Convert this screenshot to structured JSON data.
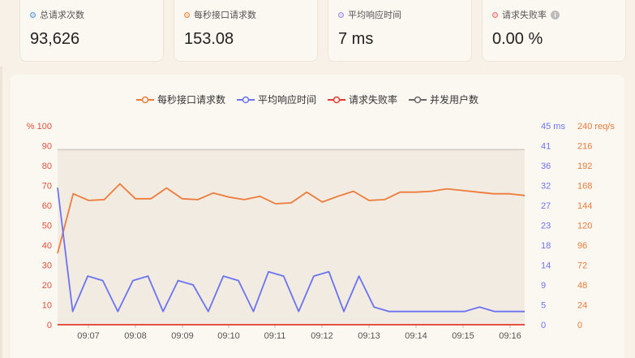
{
  "stats": [
    {
      "label": "总请求次数",
      "value": "93,626",
      "dot_color": "#5b9bd5",
      "dot_fill": "#cfe1f3"
    },
    {
      "label": "每秒接口请求数",
      "value": "153.08",
      "dot_color": "#ee8a46",
      "dot_fill": "#fbdcc6"
    },
    {
      "label": "平均响应时间",
      "value": "7 ms",
      "dot_color": "#9b8fe0",
      "dot_fill": "#e4dff8"
    },
    {
      "label": "请求失败率",
      "value": "0.00 %",
      "dot_color": "#e57070",
      "dot_fill": "#f8d3d3",
      "info": "i"
    }
  ],
  "legend": [
    {
      "label": "每秒接口请求数",
      "color": "#ed7b3a"
    },
    {
      "label": "平均响应时间",
      "color": "#6b73f0"
    },
    {
      "label": "请求失败率",
      "color": "#e23a2e"
    },
    {
      "label": "并发用户数",
      "color": "#666666"
    }
  ],
  "chart_data": {
    "type": "line",
    "x": [
      "09:06:40",
      "09:06:50",
      "09:07:00",
      "09:07:10",
      "09:07:20",
      "09:07:30",
      "09:07:40",
      "09:07:50",
      "09:08:00",
      "09:08:10",
      "09:08:20",
      "09:08:30",
      "09:08:40",
      "09:08:50",
      "09:09:00",
      "09:09:10",
      "09:09:20",
      "09:09:30",
      "09:09:40",
      "09:09:50",
      "09:10:00",
      "09:10:10",
      "09:10:20",
      "09:10:30",
      "09:10:40",
      "09:10:50",
      "09:11:00",
      "09:11:10",
      "09:11:20",
      "09:11:30",
      "09:11:40",
      "09:11:50",
      "09:12:00",
      "09:12:10",
      "09:12:20",
      "09:12:30",
      "09:12:40",
      "09:12:50",
      "09:13:00",
      "09:13:10",
      "09:13:20",
      "09:13:30",
      "09:13:40",
      "09:13:50",
      "09:14:00",
      "09:14:10",
      "09:14:20",
      "09:14:30",
      "09:14:40",
      "09:14:50",
      "09:15:00",
      "09:15:10",
      "09:15:20",
      "09:15:30",
      "09:15:40",
      "09:15:50",
      "09:16:00",
      "09:16:10",
      "09:16:20",
      "09:16:30"
    ],
    "x_ticks": [
      "09:07",
      "09:08",
      "09:09",
      "09:10",
      "09:11",
      "09:12",
      "09:13",
      "09:14",
      "09:15",
      "09:16"
    ],
    "axes": {
      "percent": {
        "ticks": [
          "% 100",
          "90",
          "80",
          "70",
          "60",
          "50",
          "40",
          "30",
          "20",
          "10",
          "0"
        ],
        "color": "#e0503a",
        "range": [
          0,
          100
        ]
      },
      "ms": {
        "ticks": [
          "45 ms",
          "41",
          "36",
          "32",
          "27",
          "23",
          "18",
          "14",
          "9",
          "5",
          "0"
        ],
        "color": "#6b73f0",
        "range": [
          0,
          45
        ]
      },
      "reqs": {
        "ticks": [
          "240 req/s",
          "216",
          "192",
          "168",
          "144",
          "120",
          "96",
          "72",
          "48",
          "24",
          "0"
        ],
        "color": "#ed7b3a",
        "range": [
          0,
          240
        ]
      }
    },
    "series": [
      {
        "name": "每秒接口请求数",
        "axis": "reqs",
        "color": "#ed7b3a",
        "values": [
          86,
          158,
          150,
          151,
          170,
          152,
          152,
          165,
          152,
          151,
          159,
          154,
          151,
          155,
          146,
          147,
          160,
          148,
          155,
          161,
          150,
          151,
          160,
          160,
          161,
          164,
          162,
          160,
          158,
          158,
          156
        ]
      },
      {
        "name": "平均响应时间",
        "axis": "ms",
        "color": "#6b73f0",
        "values": [
          31,
          3,
          11,
          10,
          3,
          10,
          11,
          3,
          10,
          9,
          3,
          11,
          10,
          3,
          12,
          11,
          3,
          11,
          12,
          3,
          11,
          4,
          3,
          3,
          3,
          3,
          3,
          3,
          4,
          3,
          3,
          3
        ]
      },
      {
        "name": "请求失败率",
        "axis": "percent",
        "color": "#e23a2e",
        "values": [
          0,
          0,
          0,
          0,
          0,
          0,
          0,
          0,
          0,
          0,
          0,
          0,
          0,
          0,
          0,
          0,
          0,
          0,
          0,
          0,
          0,
          0,
          0,
          0,
          0,
          0,
          0,
          0,
          0,
          0,
          0
        ]
      },
      {
        "name": "并发用户数",
        "axis": "percent",
        "color": "#cfcbc3",
        "area_fill": "#f1ebe2",
        "values": [
          88,
          88,
          88,
          88,
          88,
          88,
          88,
          88,
          88,
          88,
          88,
          88,
          88,
          88,
          88,
          88,
          88,
          88,
          88,
          88,
          88,
          88,
          88,
          88,
          88,
          88,
          88,
          88,
          88,
          88,
          88
        ]
      }
    ]
  }
}
